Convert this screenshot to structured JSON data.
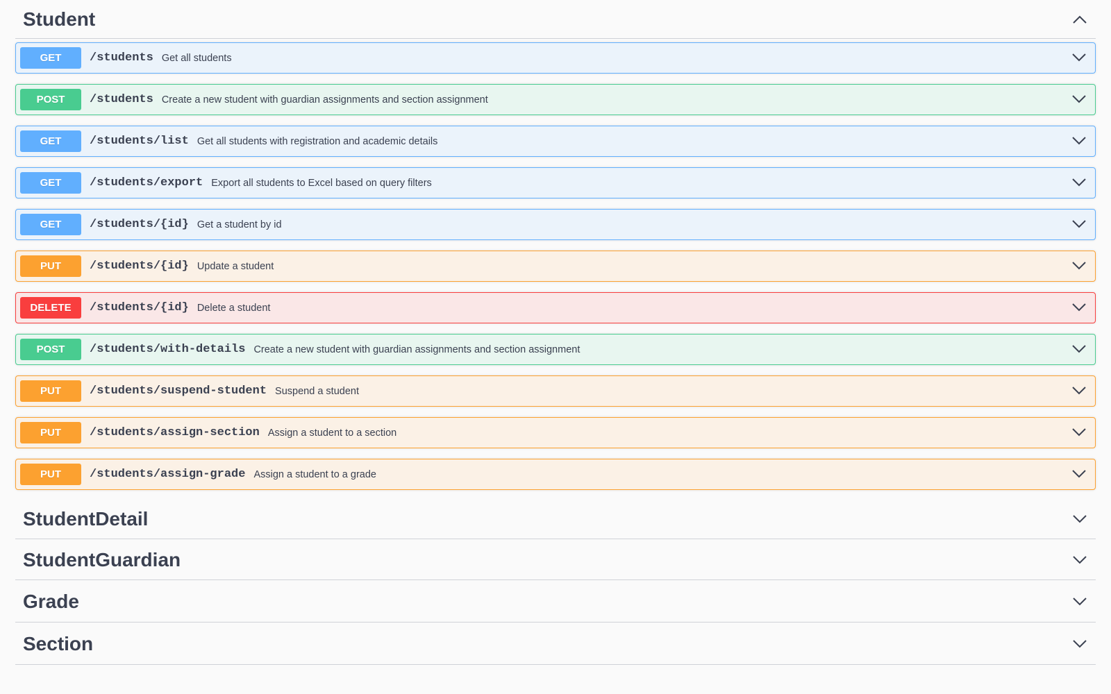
{
  "tags": {
    "student": "Student",
    "student_detail": "StudentDetail",
    "student_guardian": "StudentGuardian",
    "grade": "Grade",
    "section": "Section"
  },
  "operations": [
    {
      "method": "GET",
      "path": "/students",
      "summary": "Get all students"
    },
    {
      "method": "POST",
      "path": "/students",
      "summary": "Create a new student with guardian assignments and section assignment"
    },
    {
      "method": "GET",
      "path": "/students/list",
      "summary": "Get all students with registration and academic details"
    },
    {
      "method": "GET",
      "path": "/students/export",
      "summary": "Export all students to Excel based on query filters"
    },
    {
      "method": "GET",
      "path": "/students/{id}",
      "summary": "Get a student by id"
    },
    {
      "method": "PUT",
      "path": "/students/{id}",
      "summary": "Update a student"
    },
    {
      "method": "DELETE",
      "path": "/students/{id}",
      "summary": "Delete a student"
    },
    {
      "method": "POST",
      "path": "/students/with-details",
      "summary": "Create a new student with guardian assignments and section assignment"
    },
    {
      "method": "PUT",
      "path": "/students/suspend-student",
      "summary": "Suspend a student"
    },
    {
      "method": "PUT",
      "path": "/students/assign-section",
      "summary": "Assign a student to a section"
    },
    {
      "method": "PUT",
      "path": "/students/assign-grade",
      "summary": "Assign a student to a grade"
    }
  ],
  "icons": {
    "expanded": "chevron-up-icon",
    "collapsed": "chevron-down-icon"
  },
  "colors": {
    "get": "#61affe",
    "post": "#49cc90",
    "put": "#fca130",
    "delete": "#f93e3e",
    "text": "#3b4151"
  }
}
